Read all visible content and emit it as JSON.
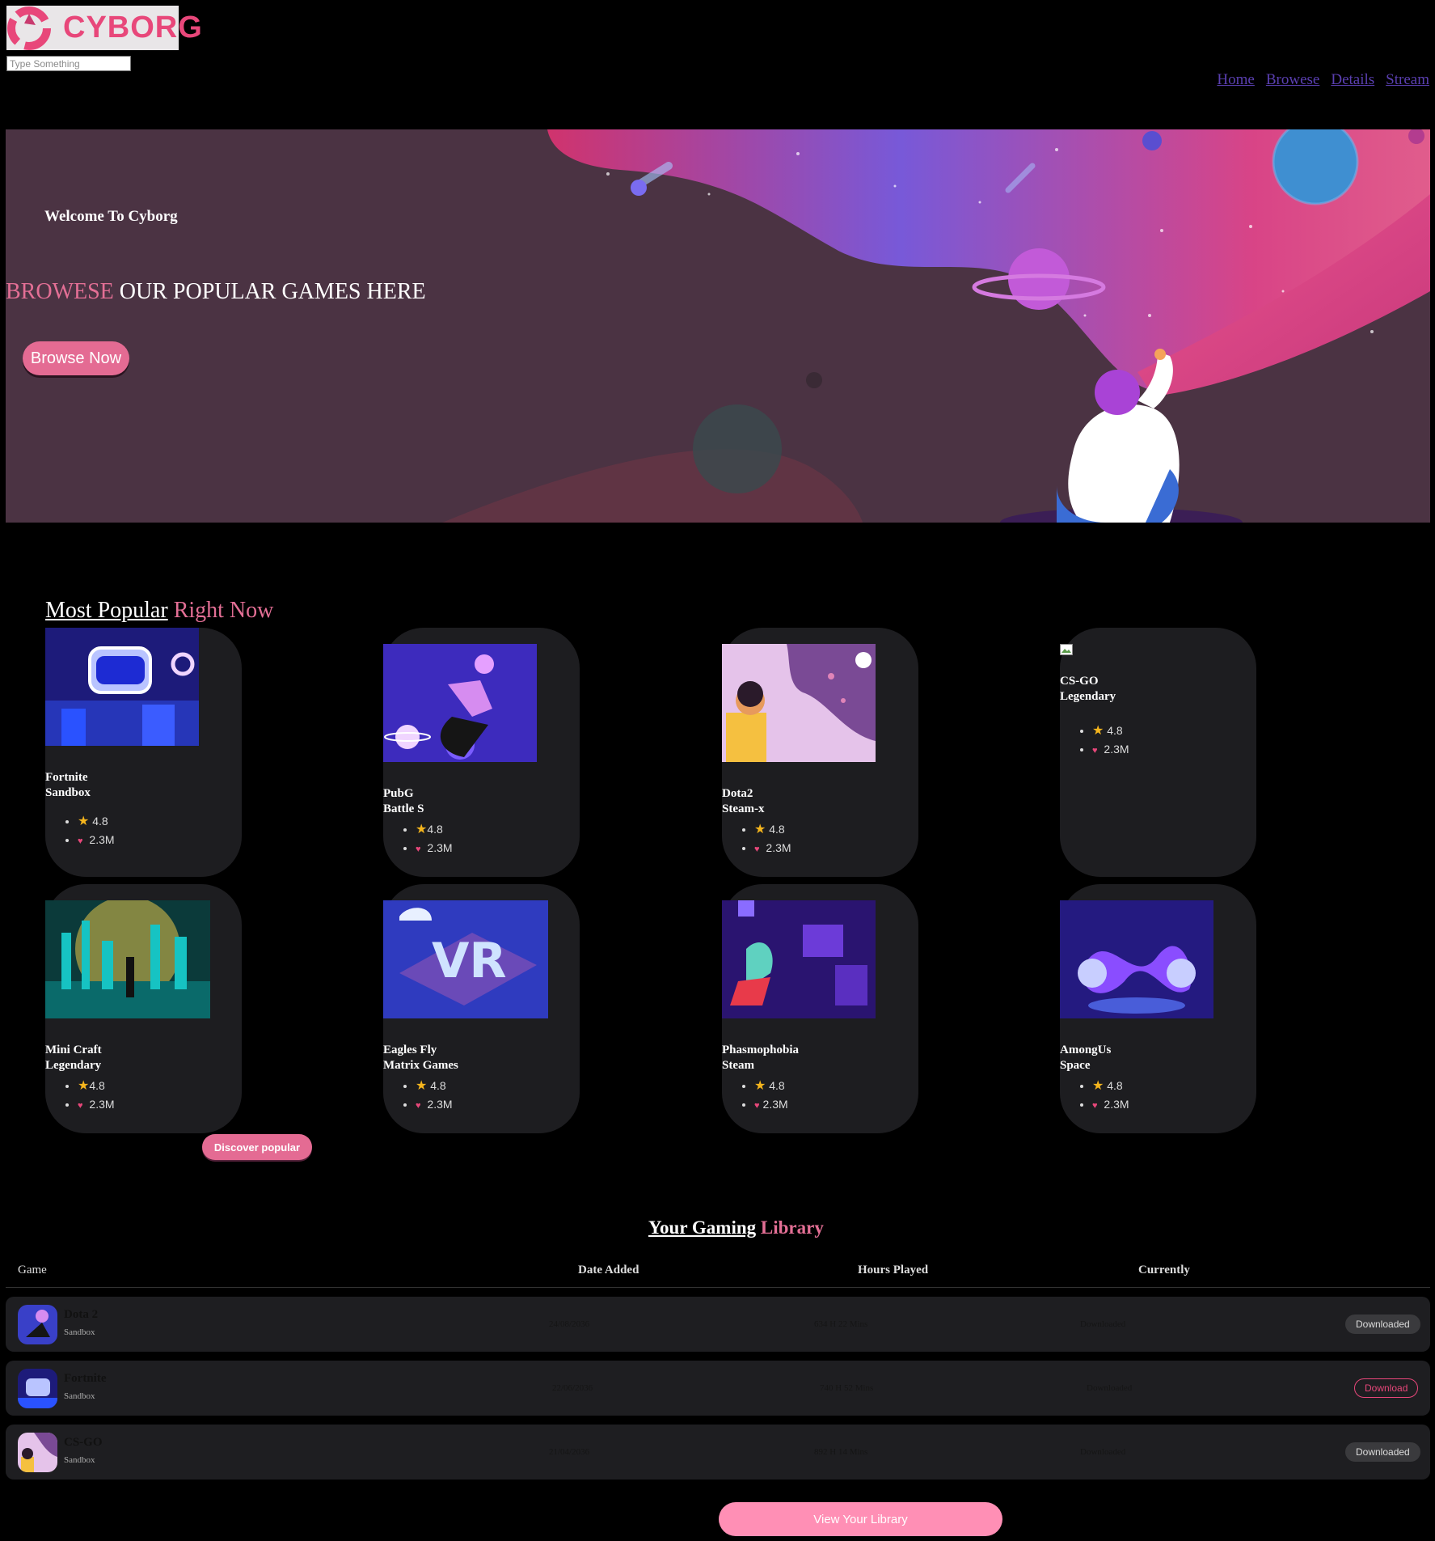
{
  "header": {
    "logo_text": "CYBORG",
    "search_placeholder": "Type Something",
    "nav": [
      "Home",
      "Browese",
      "Details",
      "Stream"
    ]
  },
  "banner": {
    "welcome": "Welcome To Cyborg",
    "headline_accent": "BROWESE",
    "headline_rest": " OUR POPULAR GAMES HERE",
    "button": "Browse Now"
  },
  "popular": {
    "title_main": "Most Popular",
    "title_accent": " Right Now",
    "games": [
      {
        "name": "Fortnite",
        "sub": "Sandbox",
        "rating": "4.8",
        "downloads": "2.3M"
      },
      {
        "name": "PubG",
        "sub": "Battle S",
        "rating": "4.8",
        "downloads": "2.3M"
      },
      {
        "name": "Dota2",
        "sub": "Steam-x",
        "rating": "4.8",
        "downloads": "2.3M"
      },
      {
        "name": "CS-GO",
        "sub": "Legendary",
        "rating": "4.8",
        "downloads": "2.3M"
      },
      {
        "name": "Mini Craft",
        "sub": "Legendary",
        "rating": "4.8",
        "downloads": "2.3M"
      },
      {
        "name": "Eagles Fly",
        "sub": "Matrix Games",
        "rating": "4.8",
        "downloads": "2.3M"
      },
      {
        "name": "Phasmophobia",
        "sub": "Steam",
        "rating": "4.8",
        "downloads": "2.3M"
      },
      {
        "name": "AmongUs",
        "sub": "Space",
        "rating": "4.8",
        "downloads": "2.3M"
      }
    ],
    "discover_button": "Discover popular"
  },
  "library": {
    "title_main": "Your Gaming",
    "title_accent": " Library",
    "columns": [
      "Game",
      "Date Added",
      "Hours Played",
      "Currently"
    ],
    "rows": [
      {
        "game": "Dota 2",
        "sub": "Sandbox",
        "date": "24/08/2036",
        "hours": "634 H 22 Mins",
        "status": "Downloaded",
        "button": "Downloaded"
      },
      {
        "game": "Fortnite",
        "sub": "Sandbox",
        "date": "22/06/2036",
        "hours": "740 H 52 Mins",
        "status": "Downloaded",
        "button": "Download"
      },
      {
        "game": "CS-GO",
        "sub": "Sandbox",
        "date": "21/04/2036",
        "hours": "892 H 14 Mins",
        "status": "Downloaded",
        "button": "Downloaded"
      }
    ],
    "view_button": "View Your Library"
  },
  "colors": {
    "accent": "#e36f95",
    "background": "#000000",
    "card": "#1d1d20"
  }
}
